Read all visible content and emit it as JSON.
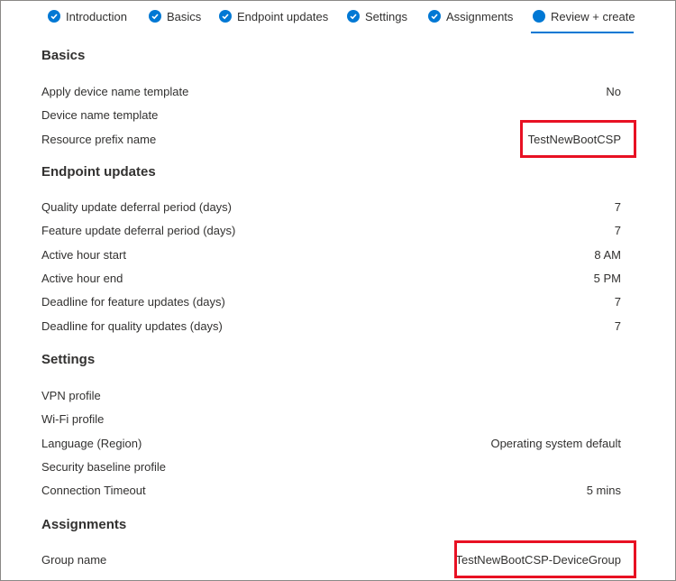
{
  "tabs": [
    {
      "label": "Introduction",
      "state": "complete",
      "icon": "checkmark-icon"
    },
    {
      "label": "Basics",
      "state": "complete",
      "icon": "checkmark-icon"
    },
    {
      "label": "Endpoint updates",
      "state": "complete",
      "icon": "checkmark-icon"
    },
    {
      "label": "Settings",
      "state": "complete",
      "icon": "checkmark-icon"
    },
    {
      "label": "Assignments",
      "state": "complete",
      "icon": "checkmark-icon"
    },
    {
      "label": "Review + create",
      "state": "active",
      "icon": "dot-icon"
    }
  ],
  "sections": {
    "basics": {
      "title": "Basics",
      "rows": [
        {
          "label": "Apply device name template",
          "value": "No"
        },
        {
          "label": "Device name template",
          "value": ""
        },
        {
          "label": "Resource prefix name",
          "value": "TestNewBootCSP"
        }
      ]
    },
    "endpoint_updates": {
      "title": "Endpoint updates",
      "rows": [
        {
          "label": "Quality update deferral period (days)",
          "value": "7"
        },
        {
          "label": "Feature update deferral period (days)",
          "value": "7"
        },
        {
          "label": "Active hour start",
          "value": "8 AM"
        },
        {
          "label": "Active hour end",
          "value": "5 PM"
        },
        {
          "label": "Deadline for feature updates (days)",
          "value": "7"
        },
        {
          "label": "Deadline for quality updates (days)",
          "value": "7"
        }
      ]
    },
    "settings": {
      "title": "Settings",
      "rows": [
        {
          "label": "VPN profile",
          "value": ""
        },
        {
          "label": "Wi-Fi profile",
          "value": ""
        },
        {
          "label": "Language (Region)",
          "value": "Operating system default"
        },
        {
          "label": "Security baseline profile",
          "value": ""
        },
        {
          "label": "Connection Timeout",
          "value": "5 mins"
        }
      ]
    },
    "assignments": {
      "title": "Assignments",
      "rows": [
        {
          "label": "Group name",
          "value": "TestNewBootCSP-DeviceGroup"
        }
      ]
    }
  },
  "colors": {
    "accent": "#0078d4",
    "highlight": "#e81123",
    "text": "#323130"
  }
}
